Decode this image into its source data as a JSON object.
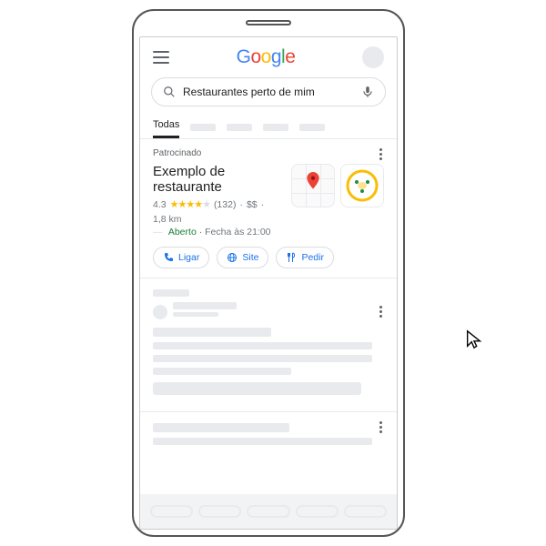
{
  "search": {
    "query": "Restaurantes perto de mim"
  },
  "tabs": {
    "active": "Todas"
  },
  "sponsored": {
    "label": "Patrocinado",
    "title": "Exemplo de restaurante",
    "rating": "4.3",
    "reviews": "(132)",
    "price": "$$",
    "distance": "1,8 km",
    "open_status": "Aberto",
    "closes_at": "Fecha às 21:00"
  },
  "actions": {
    "call": "Ligar",
    "site": "Site",
    "order": "Pedir"
  },
  "logo": {
    "g1": "G",
    "o1": "o",
    "o2": "o",
    "g2": "g",
    "l": "l",
    "e": "e"
  }
}
